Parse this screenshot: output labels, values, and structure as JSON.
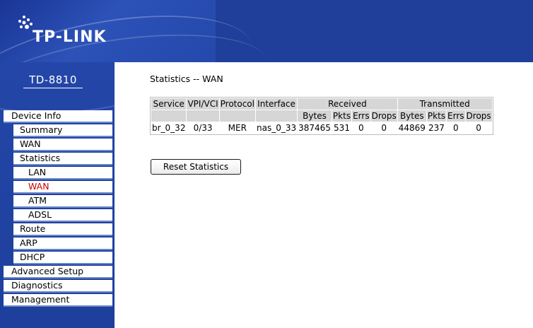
{
  "brand": {
    "logo": "TP-LINK",
    "model": "TD-8810"
  },
  "page": {
    "title": "Statistics -- WAN"
  },
  "menu": [
    {
      "label": "Device Info",
      "level": 0,
      "active": false
    },
    {
      "label": "Summary",
      "level": 1,
      "active": false
    },
    {
      "label": "WAN",
      "level": 1,
      "active": false
    },
    {
      "label": "Statistics",
      "level": 1,
      "active": false
    },
    {
      "label": "LAN",
      "level": 2,
      "active": false
    },
    {
      "label": "WAN",
      "level": 2,
      "active": true
    },
    {
      "label": "ATM",
      "level": 2,
      "active": false
    },
    {
      "label": "ADSL",
      "level": 2,
      "active": false
    },
    {
      "label": "Route",
      "level": 1,
      "active": false
    },
    {
      "label": "ARP",
      "level": 1,
      "active": false
    },
    {
      "label": "DHCP",
      "level": 1,
      "active": false
    },
    {
      "label": "Advanced Setup",
      "level": 0,
      "active": false
    },
    {
      "label": "Diagnostics",
      "level": 0,
      "active": false
    },
    {
      "label": "Management",
      "level": 0,
      "active": false
    }
  ],
  "table": {
    "h_service": "Service",
    "h_vpi": "VPI/VCI",
    "h_protocol": "Protocol",
    "h_interface": "Interface",
    "h_received": "Received",
    "h_transmitted": "Transmitted",
    "sub": [
      "Bytes",
      "Pkts",
      "Errs",
      "Drops",
      "Bytes",
      "Pkts",
      "Errs",
      "Drops"
    ],
    "row": {
      "service": "br_0_32",
      "vpi": "0/33",
      "protocol": "MER",
      "interface": "nas_0_33",
      "rx_bytes": "387465",
      "rx_pkts": "531",
      "rx_errs": "0",
      "rx_drops": "0",
      "tx_bytes": "44869",
      "tx_pkts": "237",
      "tx_errs": "0",
      "tx_drops": "0"
    }
  },
  "buttons": {
    "reset": "Reset Statistics"
  },
  "colors": {
    "navy": "#1f3f9a",
    "menu_border": "#6a87c9",
    "active": "#cc0000",
    "table_header": "#d6d6d6"
  }
}
